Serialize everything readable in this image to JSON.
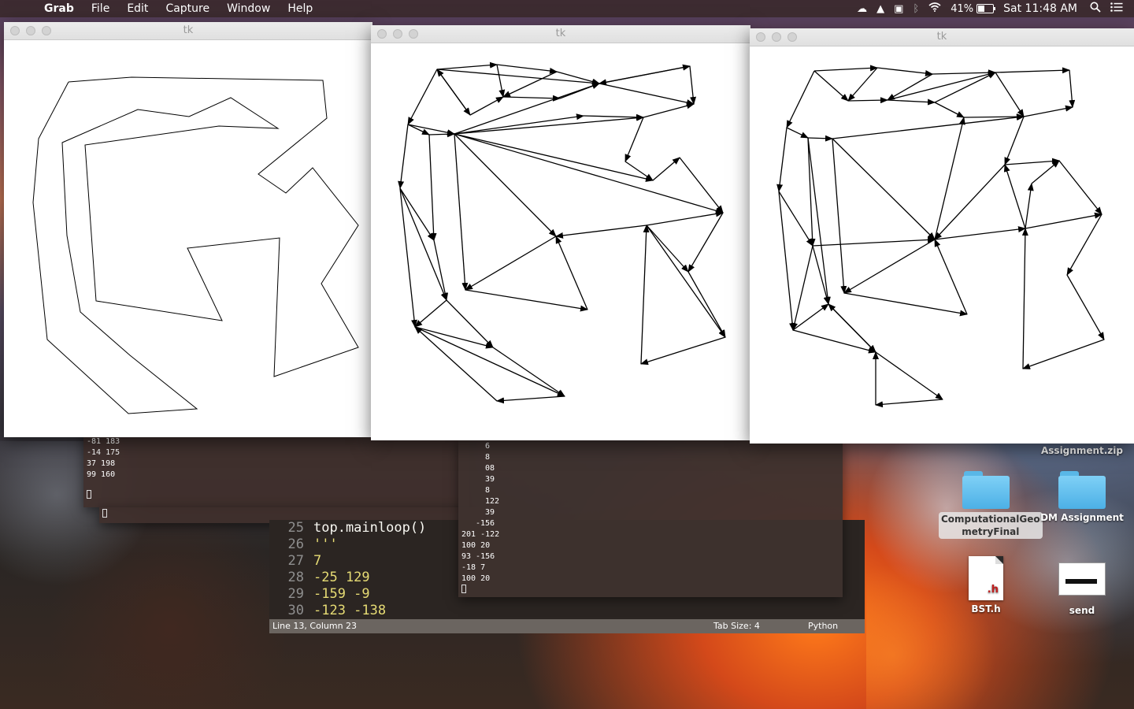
{
  "menubar": {
    "app": "Grab",
    "items": [
      "File",
      "Edit",
      "Capture",
      "Window",
      "Help"
    ],
    "battery": "41%",
    "clock": "Sat 11:48 AM",
    "icons": [
      "apple-icon",
      "cloud-icon",
      "google-drive-icon",
      "shazam-icon",
      "bluetooth-icon",
      "wifi-icon",
      "battery-icon",
      "spotlight-icon",
      "notification-center-icon"
    ]
  },
  "windows": [
    {
      "title": "tk",
      "content": "polygon outline"
    },
    {
      "title": "tk",
      "content": "directed triangulation graph"
    },
    {
      "title": "tk",
      "content": "directed triangulation graph"
    }
  ],
  "term_left": {
    "lines": [
      "-81 183",
      "-14 175",
      "37 198",
      "99 160"
    ]
  },
  "term_right": {
    "lines": [
      "6",
      "8",
      "08",
      "39",
      "8",
      "122",
      "39",
      "-156",
      "201 -122",
      "100 20",
      "93 -156",
      "-18 7",
      "100 20"
    ]
  },
  "editor": {
    "rows": [
      {
        "ln": "25",
        "code": "top.mainloop()"
      },
      {
        "ln": "26",
        "code": "'''"
      },
      {
        "ln": "27",
        "code": "7"
      },
      {
        "ln": "28",
        "code": "-25 129"
      },
      {
        "ln": "29",
        "code": "-159 -9"
      },
      {
        "ln": "30",
        "code": "-123 -138"
      }
    ],
    "status": {
      "position": "Line 13, Column 23",
      "tab_size": "Tab Size: 4",
      "syntax": "Python"
    }
  },
  "desktop": {
    "zip_label": "Assignment.zip",
    "folder1": "ComputationalGeometryFinal",
    "folder1_l1": "ComputationalGeo",
    "folder1_l2": "metryFinal",
    "folder2": "DM Assignment",
    "file1": "BST.h",
    "file1_ext": ".h",
    "file2": "send"
  }
}
